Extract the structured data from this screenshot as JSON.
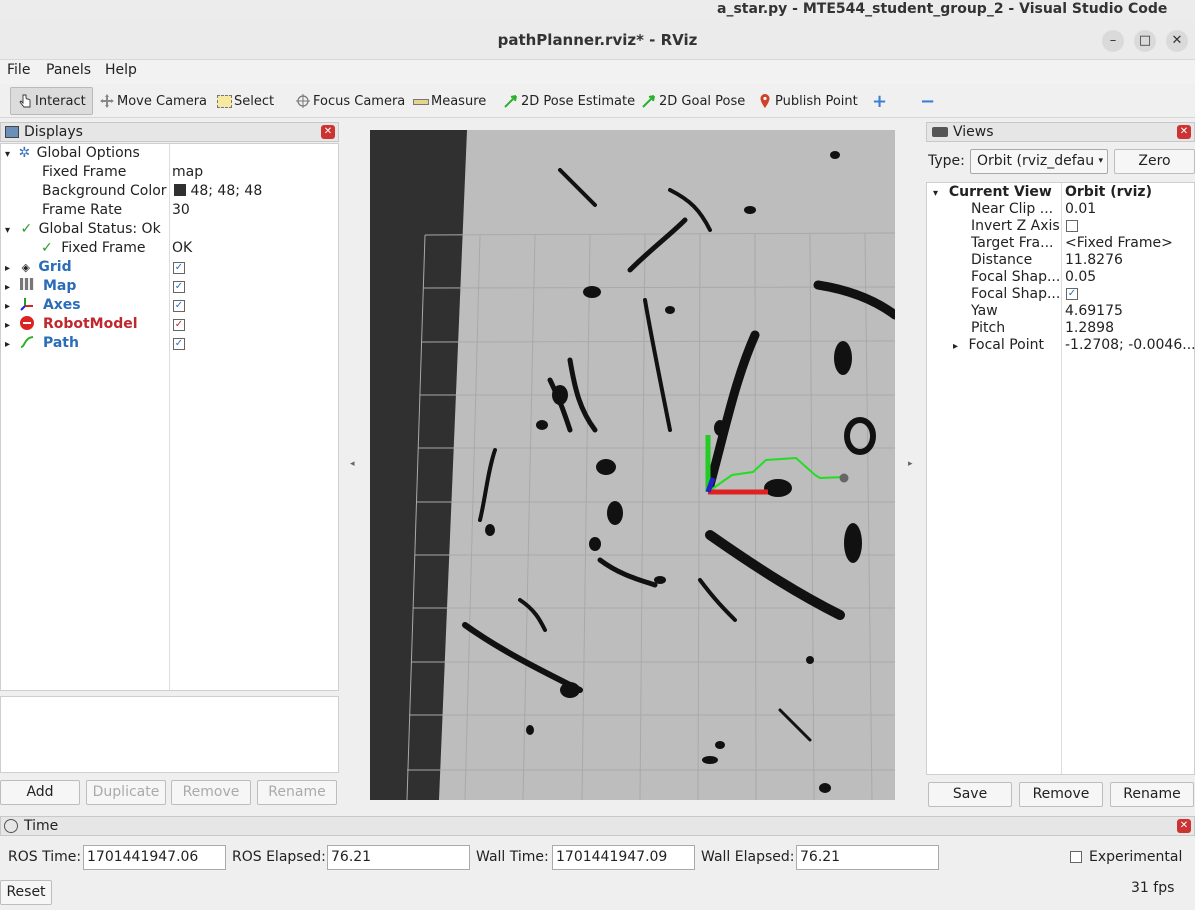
{
  "os_title": "a_star.py - MTE544_student_group_2 - Visual Studio Code",
  "window": {
    "title": "pathPlanner.rviz* - RViz",
    "min": "–",
    "max": "□",
    "close": "✕"
  },
  "menu": [
    "File",
    "Panels",
    "Help"
  ],
  "toolbar": {
    "interact": "Interact",
    "move_camera": "Move Camera",
    "select": "Select",
    "focus_camera": "Focus Camera",
    "measure": "Measure",
    "pose_estimate": "2D Pose Estimate",
    "goal_pose": "2D Goal Pose",
    "publish_point": "Publish Point",
    "plus": "+",
    "minus": "−"
  },
  "displays": {
    "title": "Displays",
    "global_options": "Global Options",
    "fixed_frame_label": "Fixed Frame",
    "fixed_frame_value": "map",
    "bg_color_label": "Background Color",
    "bg_color_value": "48; 48; 48",
    "bg_color_swatch": "#303030",
    "frame_rate_label": "Frame Rate",
    "frame_rate_value": "30",
    "global_status": "Global Status: Ok",
    "status_fixed_frame": "Fixed Frame",
    "status_fixed_value": "OK",
    "items": [
      {
        "label": "Grid",
        "color": "blue",
        "checked": true
      },
      {
        "label": "Map",
        "color": "blue",
        "checked": true
      },
      {
        "label": "Axes",
        "color": "blue",
        "checked": true
      },
      {
        "label": "RobotModel",
        "color": "red",
        "checked": true
      },
      {
        "label": "Path",
        "color": "blue",
        "checked": true
      }
    ],
    "buttons": {
      "add": "Add",
      "duplicate": "Duplicate",
      "remove": "Remove",
      "rename": "Rename"
    }
  },
  "views": {
    "title": "Views",
    "type_label": "Type:",
    "type_value": "Orbit (rviz_defau",
    "zero": "Zero",
    "current_view": "Current View",
    "current_view_value": "Orbit (rviz)",
    "props": [
      {
        "k": "Near Clip ...",
        "v": "0.01"
      },
      {
        "k": "Invert Z Axis",
        "v": ""
      },
      {
        "k": "Target Fra...",
        "v": "<Fixed Frame>"
      },
      {
        "k": "Distance",
        "v": "11.8276"
      },
      {
        "k": "Focal Shap...",
        "v": "0.05"
      },
      {
        "k": "Focal Shap...",
        "v": "✓"
      },
      {
        "k": "Yaw",
        "v": "4.69175"
      },
      {
        "k": "Pitch",
        "v": "1.2898"
      },
      {
        "k": "Focal Point",
        "v": "-1.2708; -0.0046..."
      }
    ],
    "buttons": {
      "save": "Save",
      "remove": "Remove",
      "rename": "Rename"
    }
  },
  "time": {
    "title": "Time",
    "ros_time_label": "ROS Time:",
    "ros_time": "1701441947.06",
    "ros_elapsed_label": "ROS Elapsed:",
    "ros_elapsed": "76.21",
    "wall_time_label": "Wall Time:",
    "wall_time": "1701441947.09",
    "wall_elapsed_label": "Wall Elapsed:",
    "wall_elapsed": "76.21",
    "experimental": "Experimental",
    "reset": "Reset",
    "fps": "31 fps"
  },
  "colors": {
    "accent_blue": "#2a6db8",
    "red": "#c0282e",
    "path_green": "#22dd22",
    "map_bg": "#bdbdbd",
    "occupied": "#111111"
  }
}
